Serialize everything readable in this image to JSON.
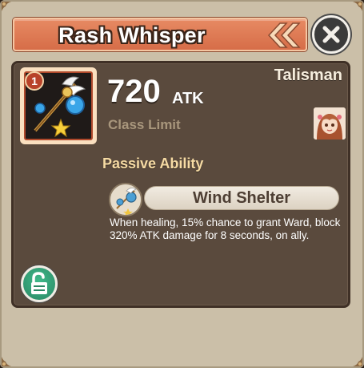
{
  "title": "Rash Whisper",
  "item": {
    "level_badge": "1",
    "atk_value": "720",
    "atk_unit": "ATK",
    "class_limit": "Class Limit",
    "type": "Talisman"
  },
  "passive": {
    "heading": "Passive Ability",
    "skill_name": "Wind Shelter",
    "description": "When healing, 15% chance to grant Ward, block 320% ATK damage for 8 seconds, on ally."
  },
  "icons": {
    "close": "close-icon",
    "lock": "unlock-icon",
    "title_decoration": "double-chevron-icon",
    "item": "talisman-wings-icon",
    "skill": "wind-shelter-icon",
    "class": "hero-portrait-icon"
  },
  "colors": {
    "title_bar": "#d66d48",
    "panel": "#5a4a3d",
    "frame": "#cbbfa8",
    "passive_heading": "#f6dba4",
    "lock_button": "#2a8764"
  }
}
